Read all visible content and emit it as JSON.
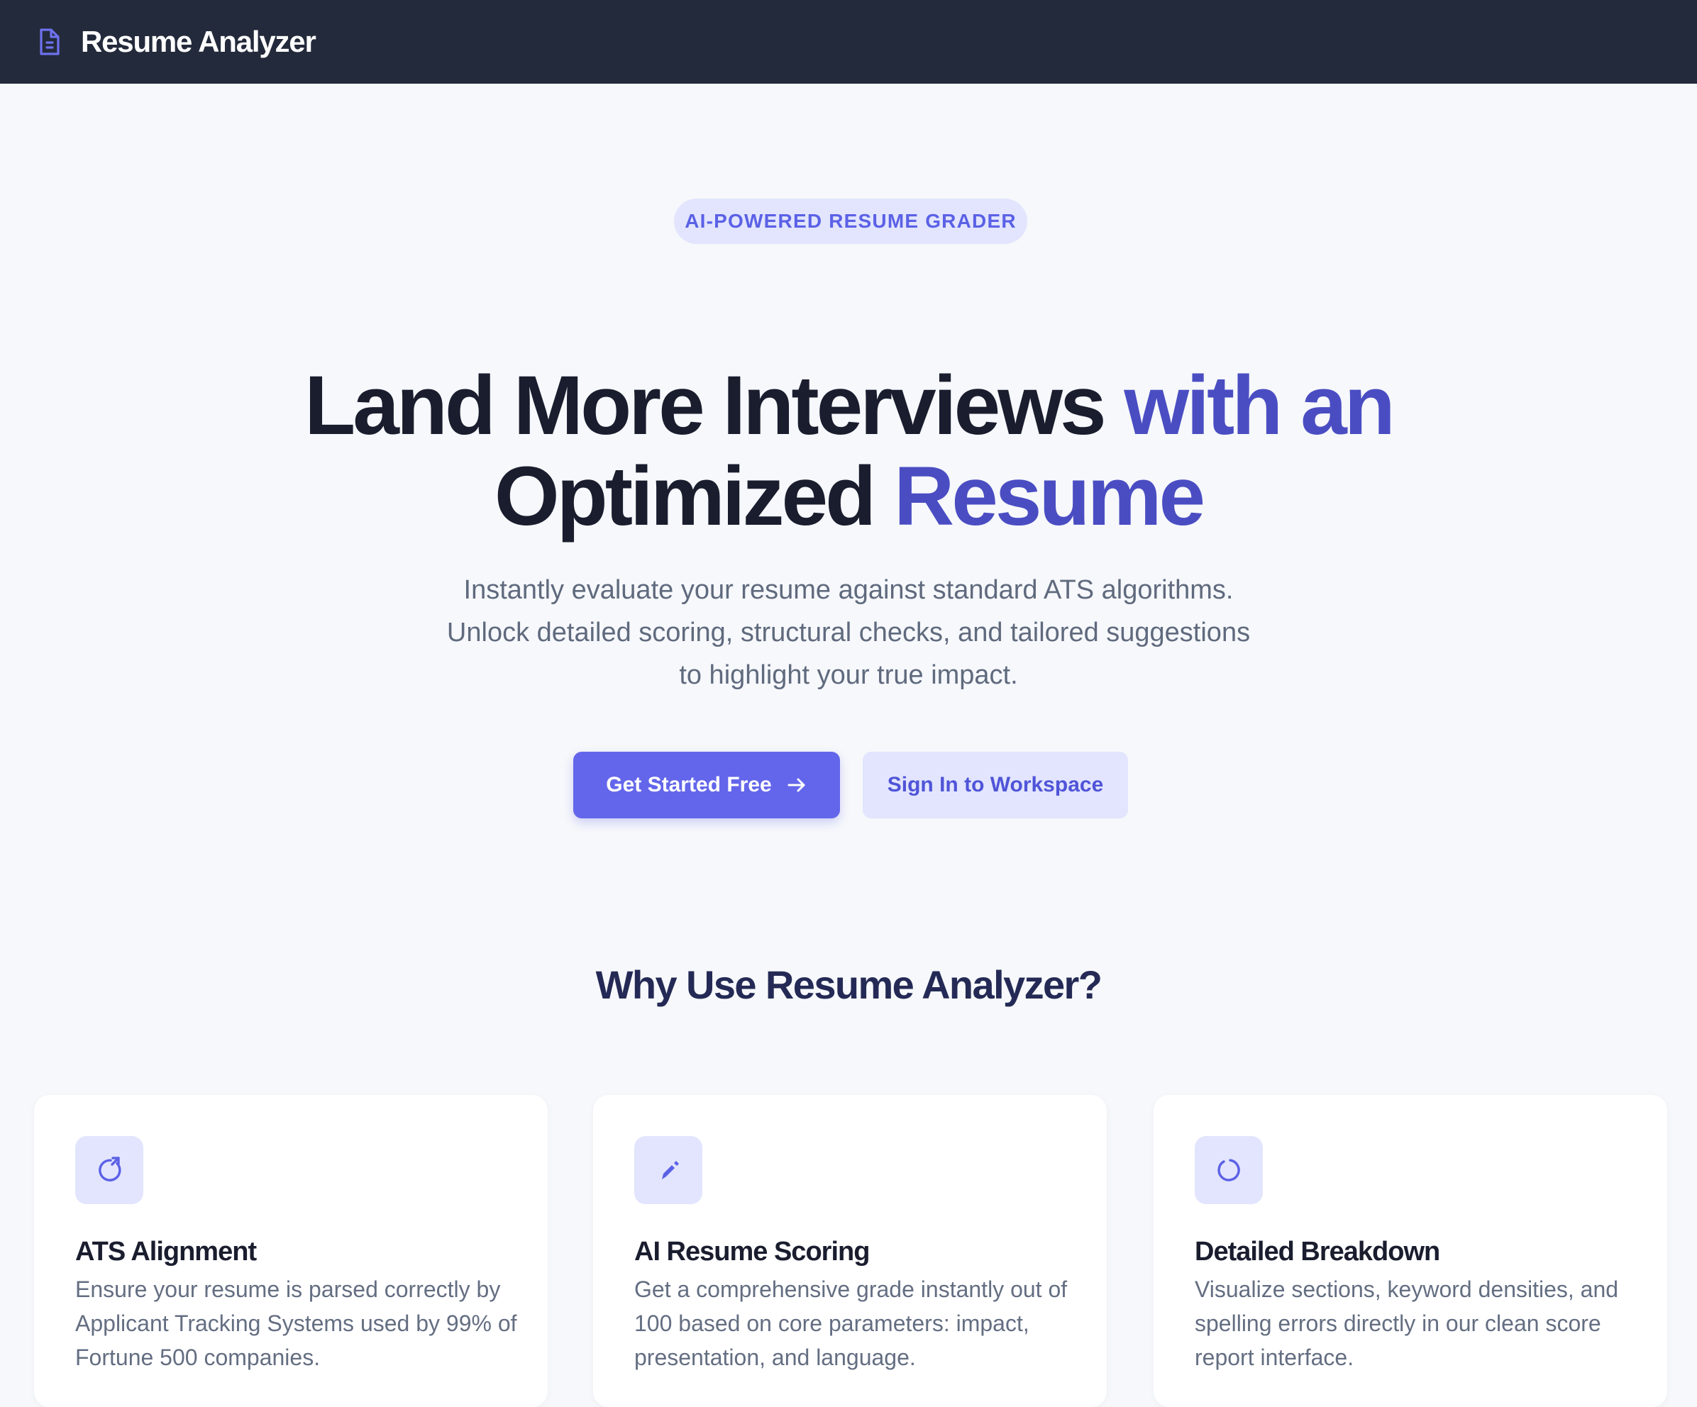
{
  "navbar": {
    "brand_name": "Resume Analyzer",
    "brand_icon": "document-icon"
  },
  "hero": {
    "badge": "AI-POWERED RESUME GRADER",
    "headline_part1": "Land More Interviews ",
    "headline_part2": "with an",
    "headline_part3": "Optimized ",
    "headline_part4": "Resume",
    "subtitle_line1": "Instantly evaluate your resume against standard ATS algorithms.",
    "subtitle_line2": "Unlock detailed scoring, structural checks, and tailored suggestions",
    "subtitle_line3": "to highlight your true impact.",
    "primary_button": "Get Started Free",
    "secondary_button": "Sign In to Workspace"
  },
  "features": {
    "title": "Why Use Resume Analyzer?",
    "items": [
      {
        "icon": "refresh-arrow-icon",
        "title": "ATS Alignment",
        "text": "Ensure your resume is parsed correctly by Applicant Tracking Systems used by 99% of Fortune 500 companies."
      },
      {
        "icon": "pencil-icon",
        "title": "AI Resume Scoring",
        "text": "Get a comprehensive grade instantly out of 100 based on core parameters: impact, presentation, and language."
      },
      {
        "icon": "circle-progress-icon",
        "title": "Detailed Breakdown",
        "text": "Visualize sections, keyword densities, and spelling errors directly in our clean score report interface."
      }
    ]
  },
  "colors": {
    "navbar_bg": "#232a3b",
    "page_bg": "#f6f8fb",
    "accent": "#6366ea",
    "accent_soft": "#e2e5fd",
    "headline_accent": "#4a4dc2"
  }
}
